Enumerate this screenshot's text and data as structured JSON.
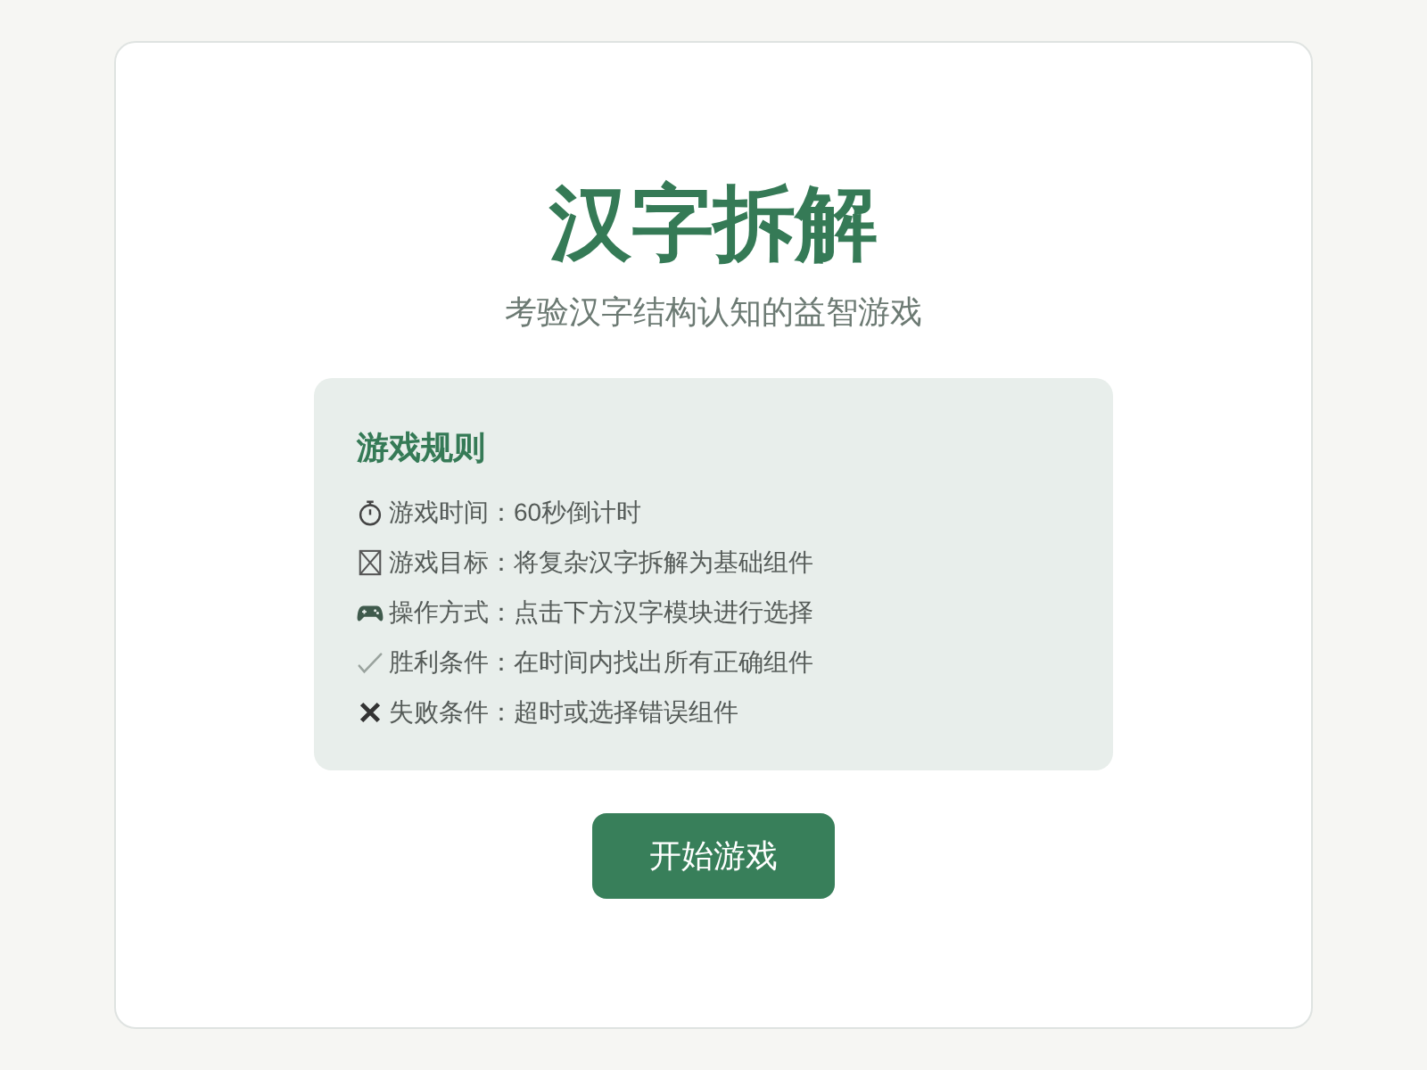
{
  "title": "汉字拆解",
  "subtitle": "考验汉字结构认知的益智游戏",
  "rules": {
    "heading": "游戏规则",
    "items": [
      {
        "kind": "timer",
        "text": "游戏时间：60秒倒计时"
      },
      {
        "kind": "goal",
        "text": "游戏目标：将复杂汉字拆解为基础组件"
      },
      {
        "kind": "control",
        "text": "操作方式：点击下方汉字模块进行选择"
      },
      {
        "kind": "win",
        "text": "胜利条件：在时间内找出所有正确组件"
      },
      {
        "kind": "lose",
        "text": "失败条件：超时或选择错误组件"
      }
    ]
  },
  "start_button": "开始游戏"
}
